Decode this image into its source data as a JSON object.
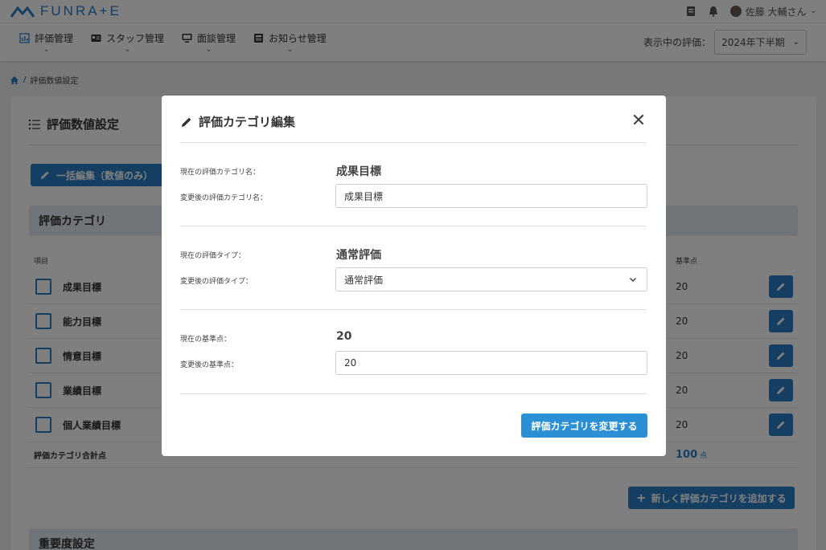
{
  "header": {
    "logo_text": "FUNRA+E",
    "user_name": "佐藤 大輔さん",
    "icons": [
      "document-icon",
      "bell-icon",
      "avatar",
      "chevron-down-icon"
    ]
  },
  "nav": {
    "items": [
      {
        "label": "評価管理",
        "icon": "chart-icon"
      },
      {
        "label": "スタッフ管理",
        "icon": "id-card-icon"
      },
      {
        "label": "面談管理",
        "icon": "monitor-icon"
      },
      {
        "label": "お知らせ管理",
        "icon": "news-icon"
      }
    ],
    "period_label": "表示中の評価：",
    "period_value": "2024年下半期"
  },
  "breadcrumb": {
    "current": "評価数値設定"
  },
  "page": {
    "title": "評価数値設定",
    "bulk_edit_label": "一括編集（数値のみ）",
    "section_title": "評価カテゴリ",
    "col_item": "項目",
    "col_points": "基準点",
    "rows": [
      {
        "name": "成果目標",
        "points": "20"
      },
      {
        "name": "能力目標",
        "points": "20"
      },
      {
        "name": "情意目標",
        "points": "20"
      },
      {
        "name": "業績目標",
        "points": "20"
      },
      {
        "name": "個人業績目標",
        "points": "20"
      }
    ],
    "total_label": "評価カテゴリ合計点",
    "total_value": "100",
    "total_unit": "点",
    "add_label": "新しく評価カテゴリを追加する",
    "next_section_title": "重要度設定"
  },
  "modal": {
    "title": "評価カテゴリ編集",
    "current_name_label": "現在の評価カテゴリ名：",
    "current_name": "成果目標",
    "new_name_label": "変更後の評価カテゴリ名：",
    "new_name": "成果目標",
    "current_type_label": "現在の評価タイプ：",
    "current_type": "通常評価",
    "new_type_label": "変更後の評価タイプ：",
    "new_type": "通常評価",
    "current_points_label": "現在の基準点：",
    "current_points": "20",
    "new_points_label": "変更後の基準点：",
    "new_points": "20",
    "submit_label": "評価カテゴリを変更する"
  },
  "colors": {
    "accent": "#2a7fc4",
    "section_bg": "#e2ebf4"
  }
}
